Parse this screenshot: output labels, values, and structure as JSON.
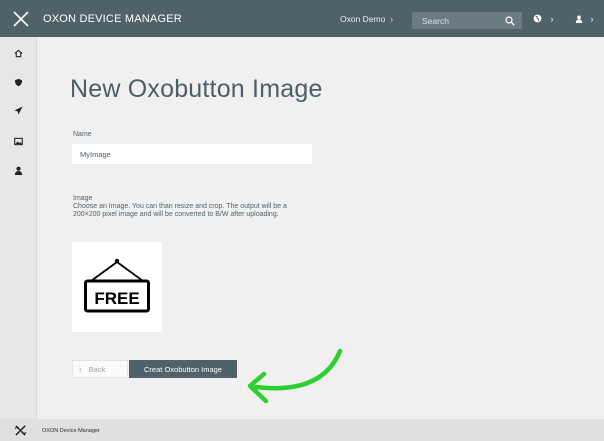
{
  "header": {
    "app_title": "OXON DEVICE MANAGER",
    "account": "Oxon Demo",
    "search_placeholder": "Search",
    "nav_chevron": "›"
  },
  "sidebar": {
    "items": [
      {
        "icon": "home-icon"
      },
      {
        "icon": "shield-icon"
      },
      {
        "icon": "send-icon"
      },
      {
        "icon": "image-icon",
        "active": true
      },
      {
        "icon": "user-icon"
      }
    ]
  },
  "main": {
    "title": "New Oxobutton Image",
    "name_label": "Name",
    "name_value": "MyImage",
    "image_label": "Image",
    "image_help": "Choose an Image. You can than resize and crop. The output will be a 200×200 pixel image and will be converted to B/W after uploading.",
    "image_sign_text": "FREE",
    "back_label": "Back",
    "create_label": "Creat Oxobutton Image"
  },
  "footer": {
    "text": "OXON Device Manager"
  },
  "colors": {
    "header_bg": "#4f6169",
    "primary_button": "#4f6169",
    "annotation_arrow": "#2fcf2f"
  }
}
